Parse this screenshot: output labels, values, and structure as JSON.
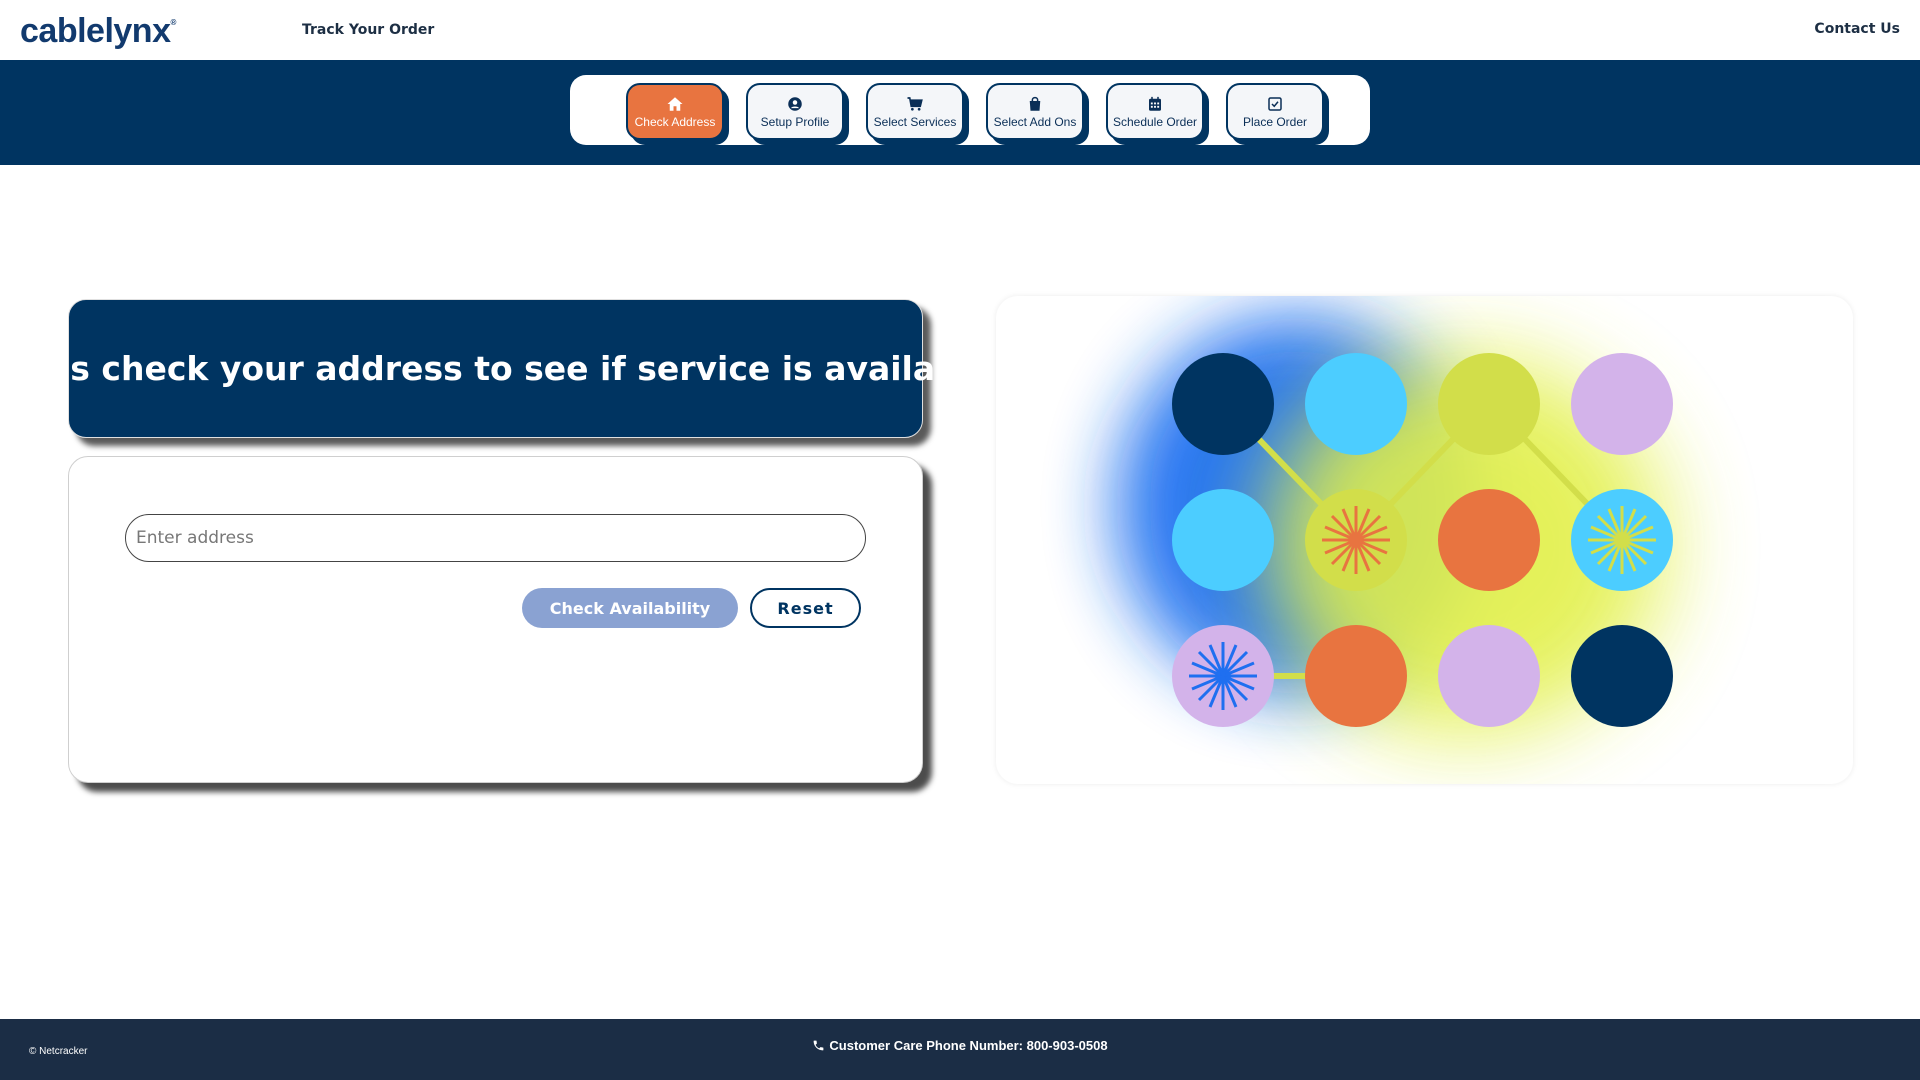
{
  "header": {
    "logo_text": "cablelynx",
    "logo_mark": "®",
    "track_order": "Track Your Order",
    "contact_us": "Contact Us"
  },
  "stepper": {
    "steps": [
      {
        "label": "Check Address",
        "icon": "home-icon",
        "active": true
      },
      {
        "label": "Setup Profile",
        "icon": "user-circle-icon",
        "active": false
      },
      {
        "label": "Select Services",
        "icon": "cart-icon",
        "active": false
      },
      {
        "label": "Select Add Ons",
        "icon": "bag-icon",
        "active": false
      },
      {
        "label": "Schedule Order",
        "icon": "calendar-icon",
        "active": false
      },
      {
        "label": "Place Order",
        "icon": "check-square-icon",
        "active": false
      }
    ]
  },
  "hero": {
    "title": "Let’s check your address to see if service is available"
  },
  "form": {
    "address_placeholder": "Enter address",
    "address_value": "",
    "check_button": "Check Availability",
    "reset_button": "Reset"
  },
  "footer": {
    "copyright": "© Netcracker",
    "phone_text": "Customer Care Phone Number: 800-903-0508"
  },
  "colors": {
    "navy": "#003461",
    "orange": "#e87440",
    "sky": "#4ccdff",
    "lime": "#d2de4a",
    "lavender": "#d3b3ea",
    "blue": "#1f6ff0",
    "button_disabled": "#8aa2d2"
  }
}
